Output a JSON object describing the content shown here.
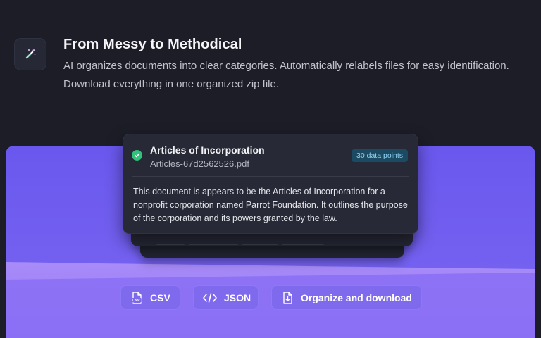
{
  "header": {
    "title": "From Messy to Methodical",
    "description": "AI organizes documents into clear categories. Automatically relabels files for easy identification. Download everything in one organized zip file.",
    "icon": "magic-wand-icon"
  },
  "document_card": {
    "title": "Articles of Incorporation",
    "filename": "Articles-67d2562526.pdf",
    "badge": "30 data points",
    "summary": "This document is appears to be the Articles of Incorporation for a nonprofit corporation named Parrot Foundation. It outlines the purpose of the corporation and its powers granted by the law.",
    "status_icon": "check-circle-icon"
  },
  "actions": {
    "csv_label": "CSV",
    "json_label": "JSON",
    "organize_label": "Organize and download"
  },
  "colors": {
    "background": "#1c1d27",
    "panel_purple": "#7a66f3",
    "card": "#272936",
    "success": "#2fc27a",
    "badge_bg": "#1d4a63",
    "badge_text": "#8fd4f2"
  }
}
